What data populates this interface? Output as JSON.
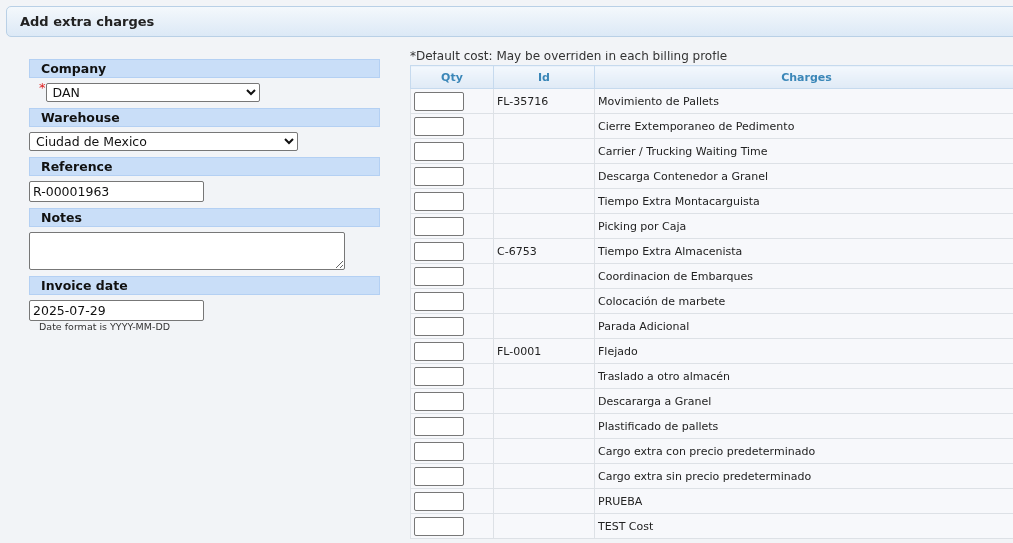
{
  "dialog": {
    "title": "Add extra charges"
  },
  "form": {
    "company": {
      "label": "Company",
      "required_mark": "*",
      "value": "DAN"
    },
    "warehouse": {
      "label": "Warehouse",
      "value": "Ciudad de Mexico"
    },
    "reference": {
      "label": "Reference",
      "value": "R-00001963"
    },
    "notes": {
      "label": "Notes"
    },
    "invoice_date": {
      "label": "Invoice date",
      "value": "2025-07-29",
      "hint": "Date format is YYYY-MM-DD"
    }
  },
  "charges": {
    "note": "*Default cost: May be overriden in each billing profle",
    "columns": [
      "Qty",
      "Id",
      "Charges"
    ],
    "rows": [
      {
        "id": "FL-35716",
        "charge": "Movimiento de Pallets"
      },
      {
        "id": "",
        "charge": "Cierre Extemporaneo de Pedimento"
      },
      {
        "id": "",
        "charge": "Carrier / Trucking Waiting Time"
      },
      {
        "id": "",
        "charge": "Descarga Contenedor a Granel"
      },
      {
        "id": "",
        "charge": "Tiempo Extra Montacarguista"
      },
      {
        "id": "",
        "charge": "Picking por Caja"
      },
      {
        "id": "C-6753",
        "charge": "Tiempo Extra Almacenista"
      },
      {
        "id": "",
        "charge": "Coordinacion de Embarques"
      },
      {
        "id": "",
        "charge": "Colocación de marbete"
      },
      {
        "id": "",
        "charge": "Parada Adicional"
      },
      {
        "id": "FL-0001",
        "charge": "Flejado"
      },
      {
        "id": "",
        "charge": "Traslado a otro almacén"
      },
      {
        "id": "",
        "charge": "Descararga a Granel"
      },
      {
        "id": "",
        "charge": "Plastificado de pallets"
      },
      {
        "id": "",
        "charge": "Cargo extra con precio predeterminado"
      },
      {
        "id": "",
        "charge": "Cargo extra sin precio predeterminado"
      },
      {
        "id": "",
        "charge": "PRUEBA"
      },
      {
        "id": "",
        "charge": "TEST Cost"
      }
    ]
  }
}
